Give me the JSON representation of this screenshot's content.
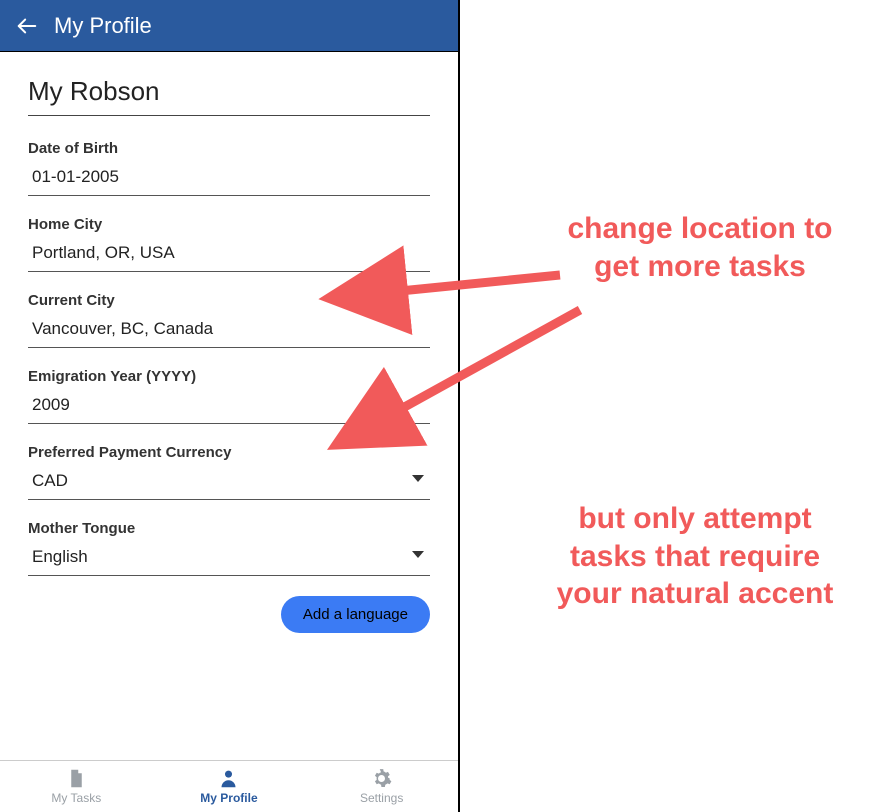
{
  "header": {
    "title": "My Profile"
  },
  "profile": {
    "username": "My Robson",
    "dob_label": "Date of Birth",
    "dob_value": "01-01-2005",
    "home_city_label": "Home City",
    "home_city_value": "Portland, OR, USA",
    "current_city_label": "Current City",
    "current_city_value": "Vancouver, BC, Canada",
    "emigration_label": "Emigration Year (YYYY)",
    "emigration_value": "2009",
    "currency_label": "Preferred Payment Currency",
    "currency_value": "CAD",
    "tongue_label": "Mother Tongue",
    "tongue_value": "English",
    "add_language_label": "Add a language"
  },
  "nav": {
    "tasks_label": "My Tasks",
    "profile_label": "My Profile",
    "settings_label": "Settings"
  },
  "annotations": {
    "a1": "change location to get more tasks",
    "a2": "but only attempt tasks that require your natural accent"
  }
}
